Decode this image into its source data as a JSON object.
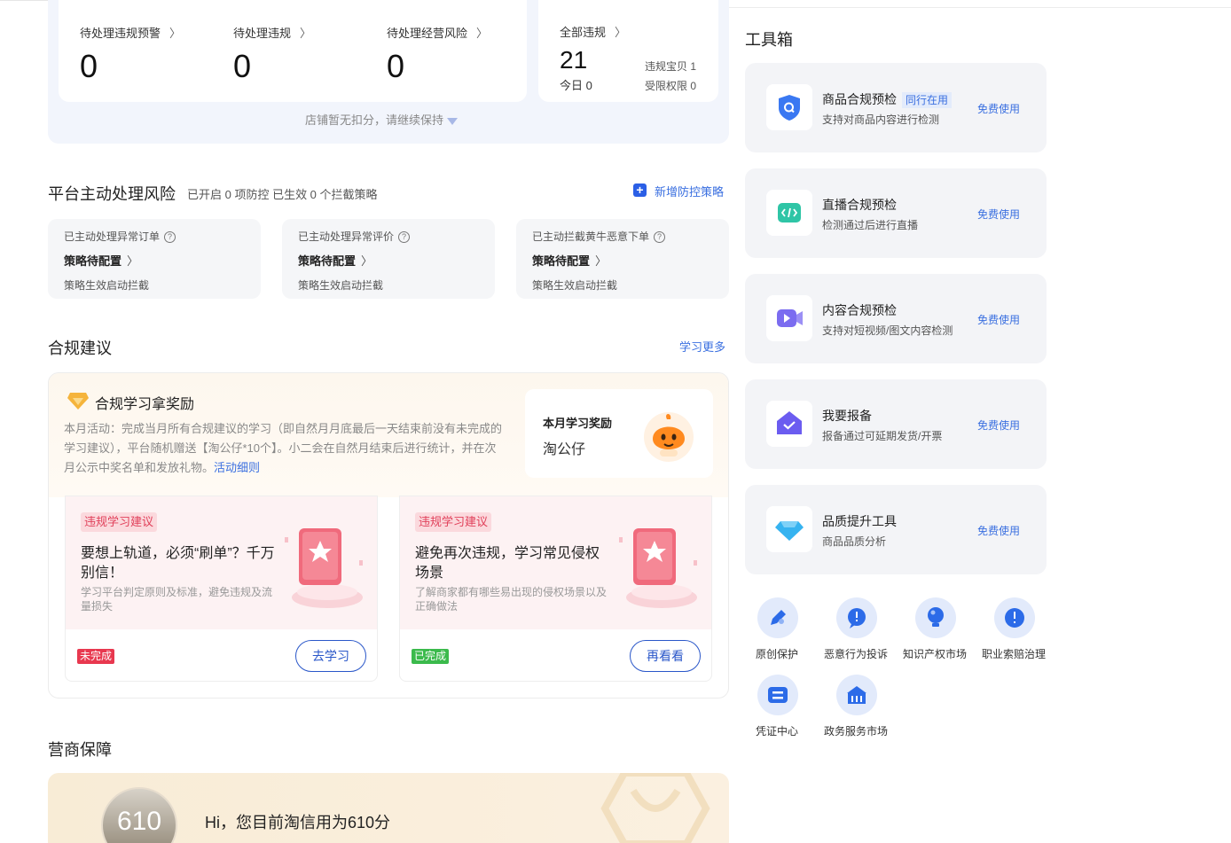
{
  "summary": {
    "items": [
      {
        "label": "待处理违规预警",
        "value": "0"
      },
      {
        "label": "待处理违规",
        "value": "0"
      },
      {
        "label": "待处理经营风险",
        "value": "0"
      }
    ],
    "all": {
      "label": "全部违规",
      "value": "21",
      "today_label": "今日",
      "today_value": "0",
      "item1": "违规宝贝 1",
      "item2": "受限权限 0"
    },
    "hint": "店铺暂无扣分，请继续保持"
  },
  "risk": {
    "title": "平台主动处理风险",
    "subtitle": "已开启 0 项防控 已生效 0 个拦截策略",
    "add_link": "新增防控策略",
    "cards": [
      {
        "title": "已主动处理异常订单",
        "status": "策略待配置",
        "desc": "策略生效启动拦截"
      },
      {
        "title": "已主动处理异常评价",
        "status": "策略待配置",
        "desc": "策略生效启动拦截"
      },
      {
        "title": "已主动拦截黄牛恶意下单",
        "status": "策略待配置",
        "desc": "策略生效启动拦截"
      }
    ]
  },
  "compliance": {
    "title": "合规建议",
    "more_link": "学习更多",
    "box_title": "合规学习拿奖励",
    "desc": "本月活动：完成当月所有合规建议的学习（即自然月月底最后一天结束前没有未完成的学习建议），平台随机赠送【淘公仔*10个】。小二会在自然月结束后进行统计，并在次月公示中奖名单和发放礼物。",
    "desc_link": "活动细则",
    "reward_title": "本月学习奖励",
    "reward_name": "淘公仔",
    "cards": [
      {
        "tag": "违规学习建议",
        "title": "要想上轨道，必须“刷单”？千万别信！",
        "desc": "学习平台判定原则及标准，避免违规及流量损失",
        "status": "未完成",
        "button": "去学习"
      },
      {
        "tag": "违规学习建议",
        "title": "避免再次违规，学习常见侵权场景",
        "desc": "了解商家都有哪些易出现的侵权场景以及正确做法",
        "status": "已完成",
        "button": "再看看"
      }
    ]
  },
  "guarantee": {
    "title": "营商保障",
    "score": "610",
    "text": "Hi，您目前淘信用为610分"
  },
  "toolbox": {
    "title": "工具箱",
    "tools": [
      {
        "name": "商品合规预检",
        "badge": "同行在用",
        "desc": "支持对商品内容进行检测",
        "link": "免费使用",
        "icon": "shield-search-icon"
      },
      {
        "name": "直播合规预检",
        "badge": "",
        "desc": "检测通过后进行直播",
        "link": "免费使用",
        "icon": "code-icon"
      },
      {
        "name": "内容合规预检",
        "badge": "",
        "desc": "支持对短视频/图文内容检测",
        "link": "免费使用",
        "icon": "video-icon"
      },
      {
        "name": "我要报备",
        "badge": "",
        "desc": "报备通过可延期发货/开票",
        "link": "免费使用",
        "icon": "house-check-icon"
      },
      {
        "name": "品质提升工具",
        "badge": "",
        "desc": "商品品质分析",
        "link": "免费使用",
        "icon": "diamond-icon"
      }
    ],
    "quick": [
      {
        "label": "原创保护",
        "icon": "pen-icon"
      },
      {
        "label": "恶意行为投诉",
        "icon": "alert-icon"
      },
      {
        "label": "知识产权市场",
        "icon": "bulb-icon"
      },
      {
        "label": "职业索赔治理",
        "icon": "alert-icon"
      },
      {
        "label": "凭证中心",
        "icon": "ticket-icon"
      },
      {
        "label": "政务服务市场",
        "icon": "bank-icon"
      }
    ]
  }
}
